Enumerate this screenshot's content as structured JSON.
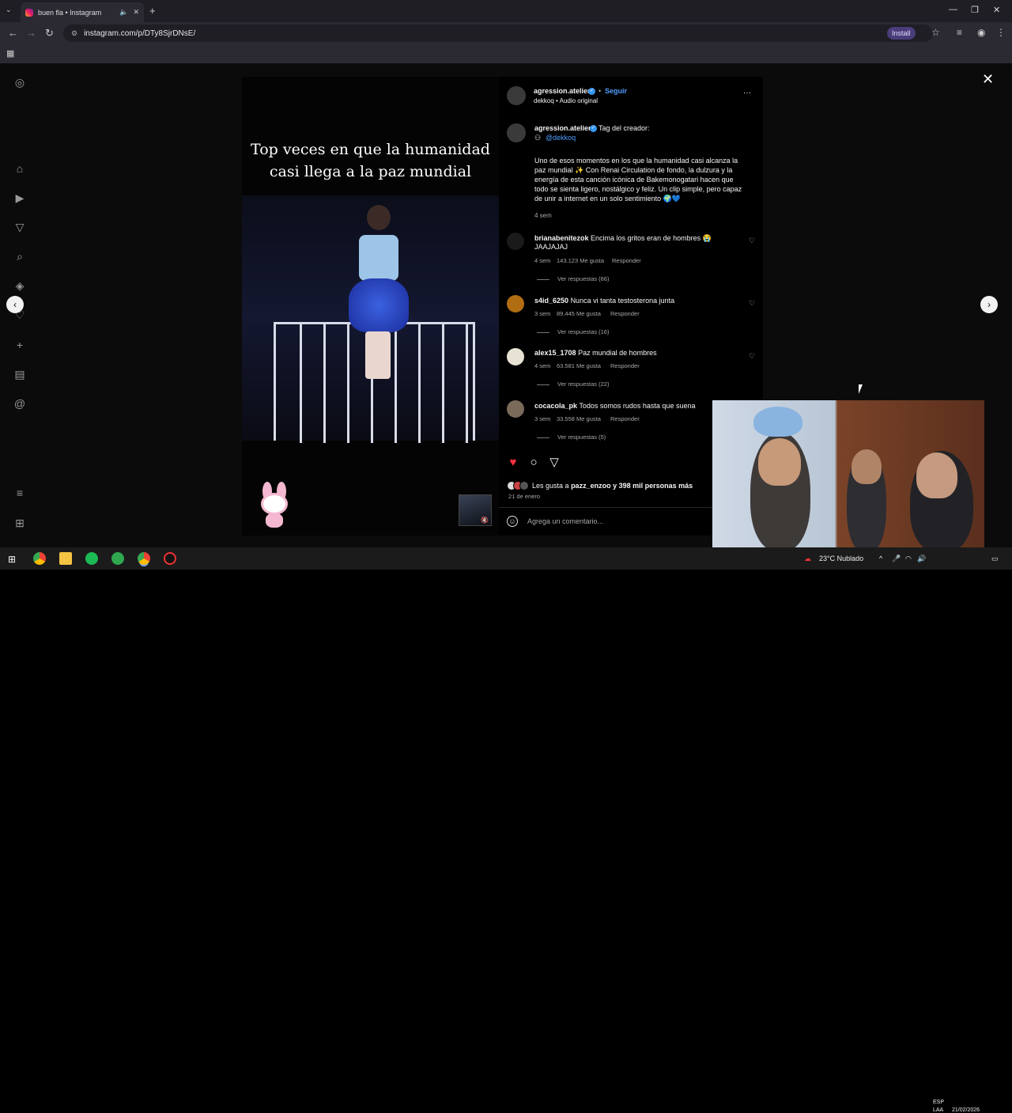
{
  "browser": {
    "tab_title": "buen fla • Instagram",
    "url": "instagram.com/p/DTy8SjrDNsE/",
    "install_label": "Install"
  },
  "post": {
    "video_caption": "Top veces en que la humanidad casi llega a la paz mundial",
    "header_username": "agression.atelier",
    "follow_label": "Seguir",
    "audio_label": "dekkoq • Audio original",
    "more_label": "···",
    "caption_username": "agression.atelier",
    "caption_tag_text": "Tag del creador:",
    "caption_mention": "@dekkoq",
    "caption_body": "Uno de esos momentos en los que la humanidad casi alcanza la paz mundial ✨ Con Renai Circulation de fondo, la dulzura y la energía de esta canción icónica de Bakemonogatari hacen que todo se sienta ligero, nostálgico y feliz. Un clip simple, pero capaz de unir a internet en un solo sentimiento 🌍💙",
    "caption_time": "4 sem"
  },
  "comments": [
    {
      "user": "brianabenitezok",
      "text": "Encima los gritos eran de hombres 😭",
      "text2": "JAAJAJAJ",
      "time": "4 sem",
      "likes": "143.123 Me gusta",
      "reply": "Responder",
      "replies": "Ver respuestas (66)",
      "avatar_color": "#1a1a1a"
    },
    {
      "user": "s4id_6250",
      "text": "Nunca vi tanta testosterona junta",
      "text2": "",
      "time": "3 sem",
      "likes": "89.445 Me gusta",
      "reply": "Responder",
      "replies": "Ver respuestas (16)",
      "avatar_color": "#b06d12"
    },
    {
      "user": "alex15_1708",
      "text": "Paz mundial de hombres",
      "text2": "",
      "time": "4 sem",
      "likes": "63.581 Me gusta",
      "reply": "Responder",
      "replies": "Ver respuestas (22)",
      "avatar_color": "#e8e2d4"
    },
    {
      "user": "cocacola_pk",
      "text": "Todos somos rudos hasta que suena",
      "text2": "",
      "time": "3 sem",
      "likes": "33.558 Me gusta",
      "reply": "Responder",
      "replies": "Ver respuestas (5)",
      "avatar_color": "#7a6a5a"
    }
  ],
  "likes": {
    "prefix": "Les gusta a",
    "user": "pazz_enzoo",
    "suffix": "y 398 mil personas más",
    "date": "21 de enero"
  },
  "comment_input": {
    "placeholder": "Agrega un comentario..."
  },
  "taskbar": {
    "weather": "23°C  Nublado",
    "lang1": "ESP",
    "lang2": "LAA",
    "time": "",
    "date": "21/02/2026"
  },
  "icons": {
    "sidebar": [
      "instagram-icon",
      "home-icon",
      "reels-icon",
      "filter-icon",
      "search-icon",
      "explore-icon",
      "heart-icon",
      "create-icon",
      "dashboard-icon",
      "threads-icon",
      "menu-icon",
      "more-icon"
    ]
  }
}
